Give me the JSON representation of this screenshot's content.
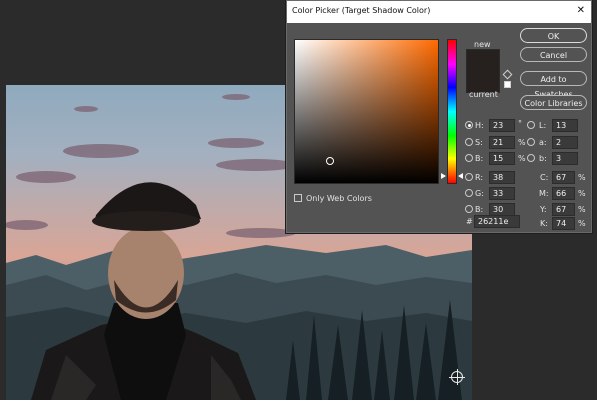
{
  "dialog": {
    "title": "Color Picker (Target Shadow Color)",
    "close_glyph": "✕",
    "new_label": "new",
    "current_label": "current",
    "new_color": "#26211e",
    "current_color": "#26211e",
    "buttons": {
      "ok": "OK",
      "cancel": "Cancel",
      "add_to_swatches": "Add to Swatches",
      "color_libraries": "Color Libraries"
    },
    "only_web_colors": "Only Web Colors",
    "hsb": [
      {
        "label": "H:",
        "value": "23",
        "unit": "°"
      },
      {
        "label": "S:",
        "value": "21",
        "unit": "%"
      },
      {
        "label": "B:",
        "value": "15",
        "unit": "%"
      }
    ],
    "rgb": [
      {
        "label": "R:",
        "value": "38"
      },
      {
        "label": "G:",
        "value": "33"
      },
      {
        "label": "B:",
        "value": "30"
      }
    ],
    "lab": [
      {
        "label": "L:",
        "value": "13"
      },
      {
        "label": "a:",
        "value": "2"
      },
      {
        "label": "b:",
        "value": "3"
      }
    ],
    "cmyk": [
      {
        "label": "C:",
        "value": "67",
        "unit": "%"
      },
      {
        "label": "M:",
        "value": "66",
        "unit": "%"
      },
      {
        "label": "Y:",
        "value": "67",
        "unit": "%"
      },
      {
        "label": "K:",
        "value": "74",
        "unit": "%"
      }
    ],
    "hex_label": "#",
    "hex_value": "26211e",
    "selected_channel": "H"
  },
  "icons": {
    "close": "close-icon",
    "gamut": "cube-icon",
    "web_safe": "square-icon",
    "target": "target-cursor-icon"
  }
}
